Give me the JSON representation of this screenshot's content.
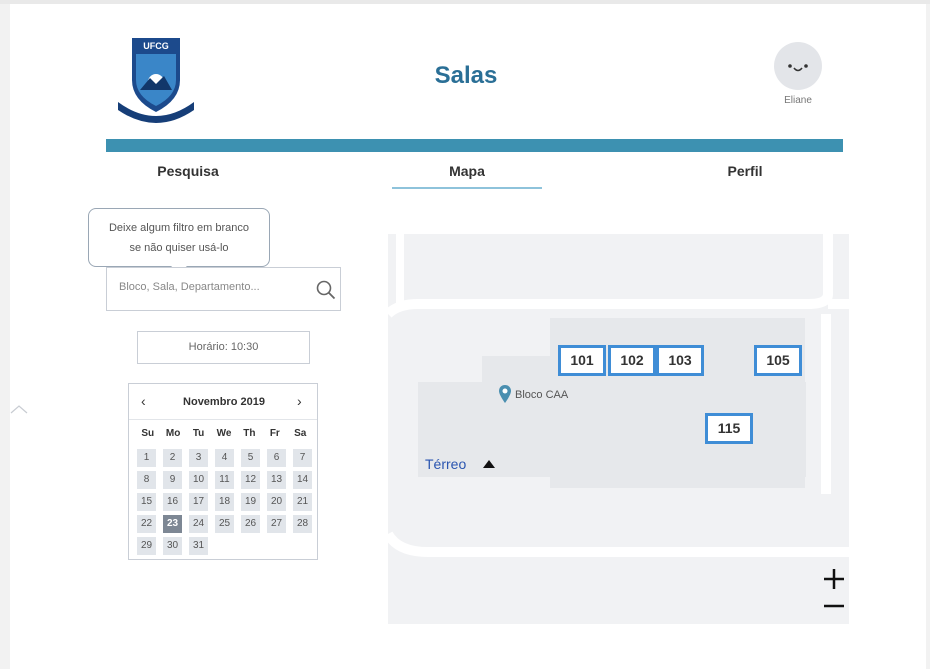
{
  "header": {
    "title": "Salas",
    "logo_text": "UFCG",
    "user_name": "Eliane"
  },
  "tabs": [
    {
      "label": "Pesquisa"
    },
    {
      "label": "Mapa",
      "active": true
    },
    {
      "label": "Perfil"
    }
  ],
  "search": {
    "tooltip_line1": "Deixe algum filtro em branco",
    "tooltip_line2": "se não quiser usá-lo",
    "placeholder": "Bloco, Sala, Departamento...",
    "value": ""
  },
  "schedule": {
    "label": "Horário: 10:30"
  },
  "calendar": {
    "month": "Novembro 2019",
    "prev": "‹",
    "next": "›",
    "weekdays": [
      "Su",
      "Mo",
      "Tu",
      "We",
      "Th",
      "Fr",
      "Sa"
    ],
    "days": [
      "1",
      "2",
      "3",
      "4",
      "5",
      "6",
      "7",
      "8",
      "9",
      "10",
      "11",
      "12",
      "13",
      "14",
      "15",
      "16",
      "17",
      "18",
      "19",
      "20",
      "21",
      "22",
      "23",
      "24",
      "25",
      "26",
      "27",
      "28",
      "29",
      "30",
      "31"
    ],
    "selected": "23"
  },
  "map": {
    "building": "Bloco CAA",
    "floor": "Térreo",
    "rooms": [
      "101",
      "102",
      "103",
      "105",
      "115"
    ],
    "zoom_in": "+",
    "zoom_out": "−"
  },
  "colors": {
    "accent_bar": "#3d91b1",
    "title": "#2a6f96",
    "room_border": "#3f8dd6"
  }
}
